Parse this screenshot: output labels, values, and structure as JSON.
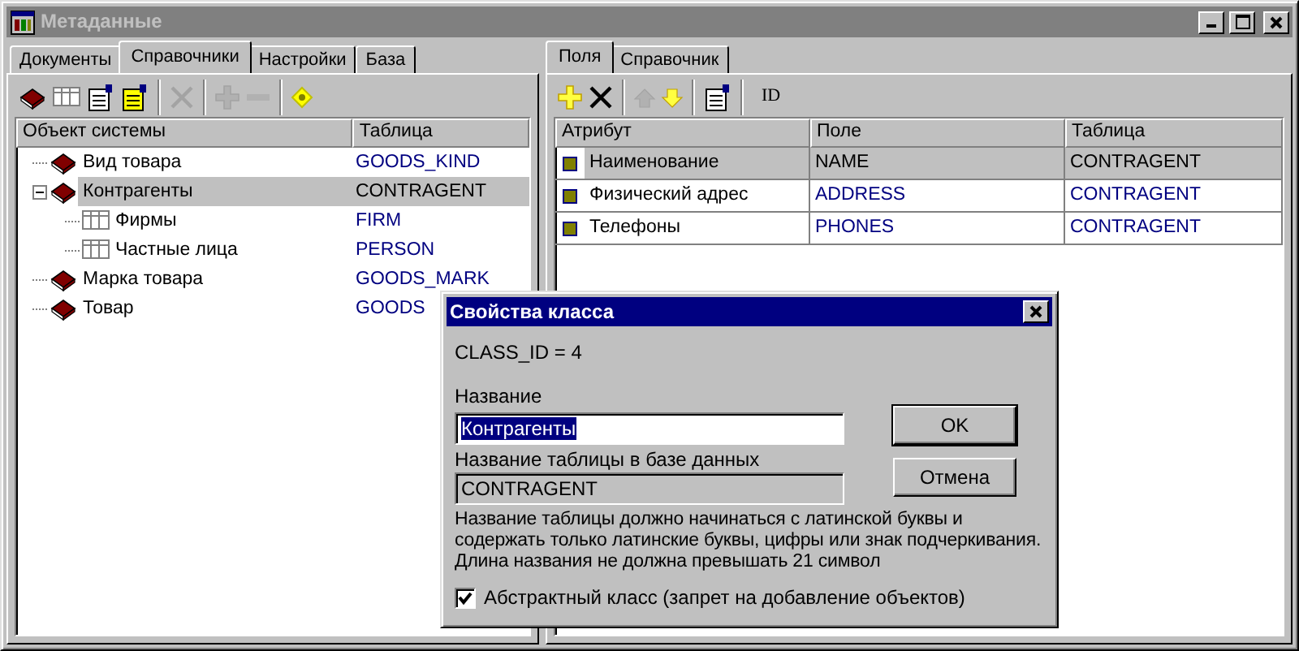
{
  "window": {
    "title": "Метаданные"
  },
  "left_tabs": [
    {
      "label": "Документы",
      "selected": false
    },
    {
      "label": "Справочники",
      "selected": true
    },
    {
      "label": "Настройки",
      "selected": false
    },
    {
      "label": "База",
      "selected": false
    }
  ],
  "left_toolbar": [
    {
      "kind": "book",
      "disabled": false
    },
    {
      "kind": "table",
      "disabled": false
    },
    {
      "kind": "props",
      "disabled": false
    },
    {
      "kind": "props-yellow",
      "disabled": false
    },
    {
      "kind": "separator"
    },
    {
      "kind": "delete",
      "disabled": true
    },
    {
      "kind": "separator"
    },
    {
      "kind": "add-plus",
      "disabled": true
    },
    {
      "kind": "remove-minus",
      "disabled": true
    },
    {
      "kind": "separator"
    },
    {
      "kind": "diamond",
      "disabled": false
    }
  ],
  "tree": {
    "columns": [
      "Объект системы",
      "Таблица"
    ],
    "items": [
      {
        "kind": "book",
        "label": "Вид товара",
        "table": "GOODS_KIND",
        "selected": false
      },
      {
        "kind": "book",
        "label": "Контрагенты",
        "table": "CONTRAGENT",
        "selected": true,
        "expanded": true,
        "children": [
          {
            "kind": "table",
            "label": "Фирмы",
            "table": "FIRM",
            "selected": false
          },
          {
            "kind": "table",
            "label": "Частные лица",
            "table": "PERSON",
            "selected": false
          }
        ]
      },
      {
        "kind": "book",
        "label": "Марка товара",
        "table": "GOODS_MARK",
        "selected": false
      },
      {
        "kind": "book",
        "label": "Товар",
        "table": "GOODS",
        "selected": false
      }
    ]
  },
  "right_tabs": [
    {
      "label": "Поля",
      "selected": true
    },
    {
      "label": "Справочник",
      "selected": false
    }
  ],
  "right_toolbar": [
    {
      "kind": "add-plus",
      "disabled": false
    },
    {
      "kind": "delete",
      "disabled": false
    },
    {
      "kind": "separator"
    },
    {
      "kind": "arrow-up",
      "disabled": true
    },
    {
      "kind": "arrow-down",
      "disabled": false
    },
    {
      "kind": "separator"
    },
    {
      "kind": "props",
      "disabled": false
    },
    {
      "kind": "separator"
    },
    {
      "kind": "text",
      "label": "ID"
    }
  ],
  "fields": {
    "columns": [
      "Атрибут",
      "Поле",
      "Таблица"
    ],
    "rows": [
      {
        "attribute": "Наименование",
        "field": "NAME",
        "table": "CONTRAGENT",
        "selected": true
      },
      {
        "attribute": "Физический адрес",
        "field": "ADDRESS",
        "table": "CONTRAGENT",
        "selected": false
      },
      {
        "attribute": "Телефоны",
        "field": "PHONES",
        "table": "CONTRAGENT",
        "selected": false
      }
    ]
  },
  "dialog": {
    "title": "Свойства класса",
    "class_id": "CLASS_ID = 4",
    "name_label": "Название",
    "name_value": "Контрагенты",
    "name_value_selected": true,
    "table_label": "Название таблицы в базе данных",
    "table_value": "CONTRAGENT",
    "table_disabled": true,
    "hint": "Название таблицы должно начинаться с латинской буквы и\nсодержать только латинские буквы, цифры или знак подчеркивания.\nДлина названия не должна превышать 21 символ",
    "checkbox": {
      "label": "Абстрактный класс (запрет на добавление объектов)",
      "checked": true
    },
    "buttons": [
      {
        "label": "OK",
        "default": true
      },
      {
        "label": "Отмена",
        "default": false
      }
    ]
  }
}
